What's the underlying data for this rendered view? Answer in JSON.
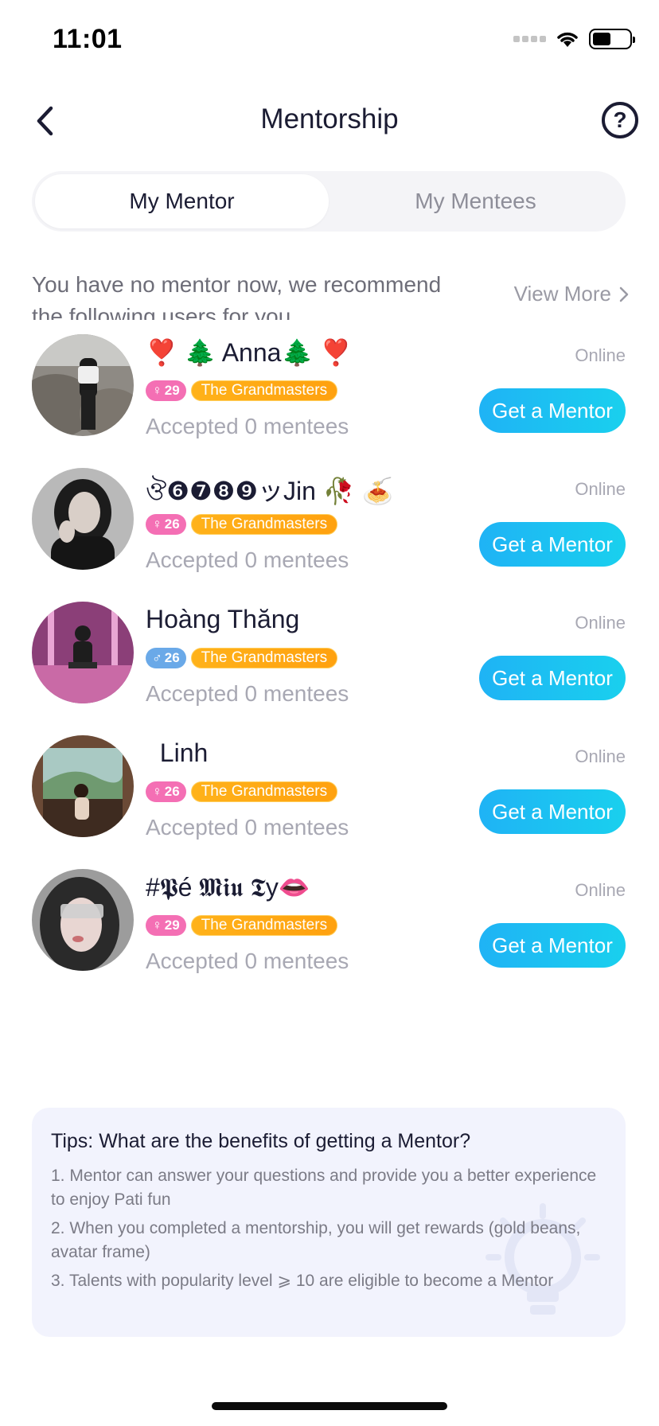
{
  "status_bar": {
    "time": "11:01"
  },
  "nav": {
    "title": "Mentorship"
  },
  "tabs": [
    {
      "label": "My Mentor",
      "active": true
    },
    {
      "label": "My Mentees",
      "active": false
    }
  ],
  "intro": {
    "text": "You have no mentor now, we recommend the following users for you",
    "view_more": "View More"
  },
  "mentors": [
    {
      "name": "❣️ 🌲 Anna🌲 ❣️",
      "gender": "female",
      "gender_symbol": "♀",
      "age": "29",
      "level": "The Grandmasters",
      "accepted": "Accepted 0 mentees",
      "status": "Online",
      "button": "Get a Mentor"
    },
    {
      "name": "ঔ❻❼❽❾ッJin 🥀 🍝",
      "gender": "female",
      "gender_symbol": "♀",
      "age": "26",
      "level": "The Grandmasters",
      "accepted": "Accepted 0 mentees",
      "status": "Online",
      "button": "Get a Mentor"
    },
    {
      "name": "Hoàng Thăng",
      "gender": "male",
      "gender_symbol": "♂",
      "age": "26",
      "level": "The Grandmasters",
      "accepted": "Accepted 0 mentees",
      "status": "Online",
      "button": "Get a Mentor"
    },
    {
      "name": "  Linh",
      "gender": "female",
      "gender_symbol": "♀",
      "age": "26",
      "level": "The Grandmasters",
      "accepted": "Accepted 0 mentees",
      "status": "Online",
      "button": "Get a Mentor"
    },
    {
      "name": "#𝕻é 𝕸𝖎𝖚 𝕿y👄",
      "gender": "female",
      "gender_symbol": "♀",
      "age": "29",
      "level": "The Grandmasters",
      "accepted": "Accepted 0 mentees",
      "status": "Online",
      "button": "Get a Mentor"
    }
  ],
  "tips": {
    "title": "Tips: What are the benefits of getting a Mentor?",
    "items": [
      "1. Mentor can answer your questions and provide you a better experience to enjoy Pati fun",
      "2. When you completed a mentorship, you will get rewards (gold beans, avatar frame)",
      "3. Talents with popularity level ⩾ 10 are eligible to become a Mentor"
    ]
  },
  "colors": {
    "accent_button": "#1fb3f5",
    "level_badge": "#ffa10f",
    "female_badge": "#f46fb4",
    "male_badge": "#6aa9e8"
  }
}
